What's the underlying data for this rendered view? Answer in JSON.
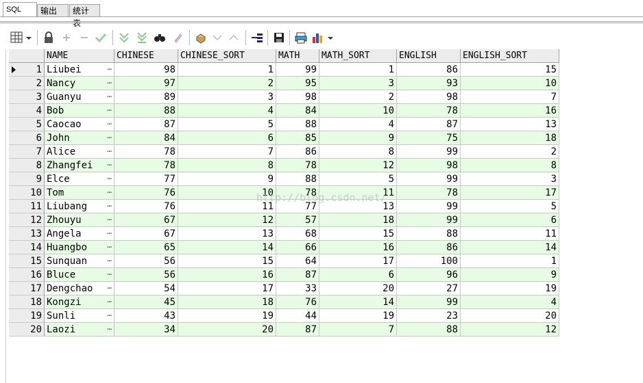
{
  "tabs": [
    {
      "label": "SQL",
      "active": true
    },
    {
      "label": "输出",
      "active": false
    },
    {
      "label": "统计表",
      "active": false
    }
  ],
  "toolbar": {
    "icons": [
      "grid-view-icon",
      "lock-icon",
      "plus-icon",
      "minus-icon",
      "check-icon",
      "fetch-next-icon",
      "fetch-all-icon",
      "find-icon",
      "clear-icon",
      "query-by-example-icon",
      "sort-down-icon",
      "sort-up-icon",
      "export-icon",
      "save-icon",
      "print-icon",
      "chart-icon"
    ]
  },
  "watermark": "http://blog.csdn.net/",
  "grid": {
    "columns": [
      "NAME",
      "CHINESE",
      "CHINESE_SORT",
      "MATH",
      "MATH_SORT",
      "ENGLISH",
      "ENGLISH_SORT"
    ],
    "rows": [
      [
        "1",
        "Liubei",
        "98",
        "1",
        "99",
        "1",
        "86",
        "15"
      ],
      [
        "2",
        "Nancy",
        "97",
        "2",
        "95",
        "3",
        "93",
        "10"
      ],
      [
        "3",
        "Guanyu",
        "89",
        "3",
        "98",
        "2",
        "98",
        "7"
      ],
      [
        "4",
        "Bob",
        "88",
        "4",
        "84",
        "10",
        "78",
        "16"
      ],
      [
        "5",
        "Caocao",
        "87",
        "5",
        "88",
        "4",
        "87",
        "13"
      ],
      [
        "6",
        "John",
        "84",
        "6",
        "85",
        "9",
        "75",
        "18"
      ],
      [
        "7",
        "Alice",
        "78",
        "7",
        "86",
        "8",
        "99",
        "2"
      ],
      [
        "8",
        "Zhangfei",
        "78",
        "8",
        "78",
        "12",
        "98",
        "8"
      ],
      [
        "9",
        "Elce",
        "77",
        "9",
        "88",
        "5",
        "99",
        "3"
      ],
      [
        "10",
        "Tom",
        "76",
        "10",
        "78",
        "11",
        "78",
        "17"
      ],
      [
        "11",
        "Liubang",
        "76",
        "11",
        "77",
        "13",
        "99",
        "5"
      ],
      [
        "12",
        "Zhouyu",
        "67",
        "12",
        "57",
        "18",
        "99",
        "6"
      ],
      [
        "13",
        "Angela",
        "67",
        "13",
        "68",
        "15",
        "88",
        "11"
      ],
      [
        "14",
        "Huangbo",
        "65",
        "14",
        "66",
        "16",
        "86",
        "14"
      ],
      [
        "15",
        "Sunquan",
        "56",
        "15",
        "64",
        "17",
        "100",
        "1"
      ],
      [
        "16",
        "Bluce",
        "56",
        "16",
        "87",
        "6",
        "96",
        "9"
      ],
      [
        "17",
        "Dengchao",
        "54",
        "17",
        "33",
        "20",
        "27",
        "19"
      ],
      [
        "18",
        "Kongzi",
        "45",
        "18",
        "76",
        "14",
        "99",
        "4"
      ],
      [
        "19",
        "Sunli",
        "43",
        "19",
        "44",
        "19",
        "23",
        "20"
      ],
      [
        "20",
        "Laozi",
        "34",
        "20",
        "87",
        "7",
        "88",
        "12"
      ]
    ]
  }
}
